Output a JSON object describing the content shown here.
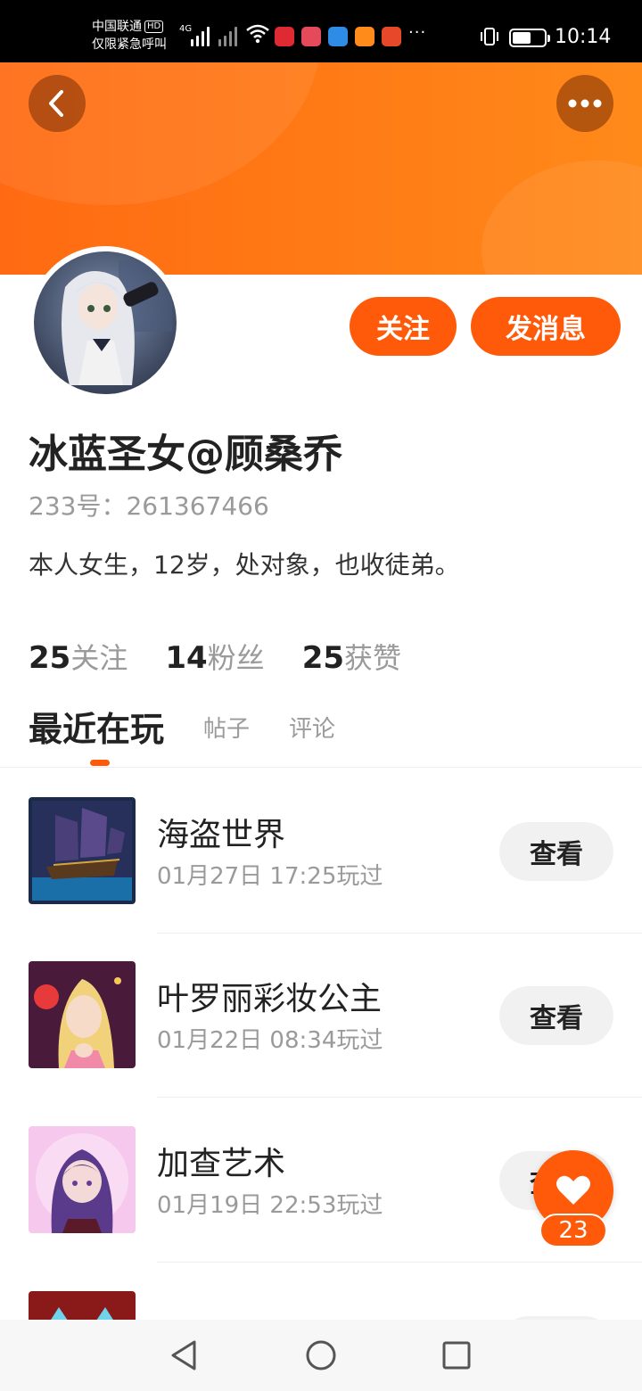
{
  "status_bar": {
    "carrier_line1": "中国联通",
    "carrier_hd": "HD",
    "carrier_line2": "仅限紧急呼叫",
    "network": "4G",
    "more": "···",
    "time": "10:14",
    "battery_level": 0.5
  },
  "header": {
    "back_icon": "chevron-left-icon",
    "more_icon": "more-dots-icon",
    "accent_color": "#ff5a0a"
  },
  "profile": {
    "username": "冰蓝圣女@顾桑乔",
    "id_text": "233号：261367466",
    "bio": "本人女生，12岁，处对象，也收徒弟。",
    "follow_label": "关注",
    "message_label": "发消息",
    "stats": [
      {
        "value": "25",
        "label": "关注"
      },
      {
        "value": "14",
        "label": "粉丝"
      },
      {
        "value": "25",
        "label": "获赞"
      }
    ]
  },
  "tabs": [
    {
      "label": "最近在玩",
      "active": true
    },
    {
      "label": "帖子",
      "active": false
    },
    {
      "label": "评论",
      "active": false
    }
  ],
  "games": [
    {
      "name": "海盗世界",
      "time": "01月27日 17:25玩过",
      "button": "查看"
    },
    {
      "name": "叶罗丽彩妆公主",
      "time": "01月22日 08:34玩过",
      "button": "查看"
    },
    {
      "name": "加查艺术",
      "time": "01月19日 22:53玩过",
      "button": "查看"
    },
    {
      "name": "",
      "time": "",
      "button": ""
    }
  ],
  "like": {
    "icon": "heart-icon",
    "count": "23"
  },
  "nav": {
    "back_icon": "triangle-back-icon",
    "home_icon": "circle-home-icon",
    "recent_icon": "square-recent-icon"
  }
}
